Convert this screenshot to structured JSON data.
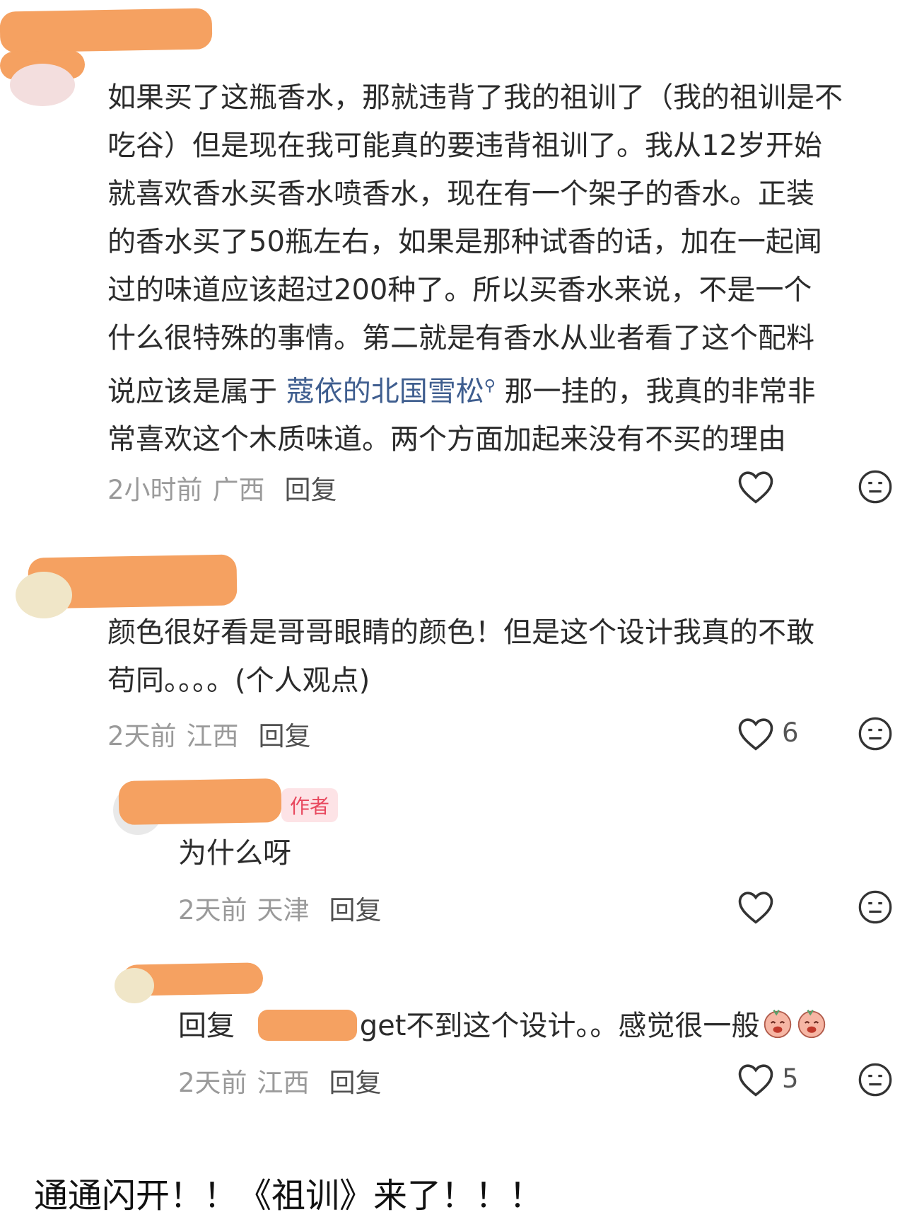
{
  "comments": [
    {
      "lines": [
        "如果买了这瓶香水，那就违背了我的祖训了（我的祖训是不",
        "吃谷）但是现在我可能真的要违背祖训了。我从12岁开始",
        "就喜欢香水买香水喷香水，现在有一个架子的香水。正装",
        "的香水买了50瓶左右，如果是那种试香的话，加在一起闻",
        "过的味道应该超过200种了。所以买香水来说，不是一个",
        "什么很特殊的事情。第二就是有香水从业者看了这个配料"
      ],
      "line7_pre": "说应该是属于 ",
      "line7_link": "蔻依的北国雪松",
      "line7_post": " 那一挂的，我真的非常非",
      "line8": "常喜欢这个木质味道。两个方面加起来没有不买的理由",
      "time": "2小时前",
      "region": "广西",
      "reply": "回复"
    },
    {
      "lines": [
        "颜色很好看是哥哥眼睛的颜色！但是这个设计我真的不敢",
        "苟同。。。。(个人观点)"
      ],
      "time": "2天前",
      "region": "江西",
      "reply": "回复",
      "likes": "6"
    },
    {
      "badge": "作者",
      "text": "为什么呀",
      "time": "2天前",
      "region": "天津",
      "reply": "回复"
    },
    {
      "reply_prefix": "回复",
      "text": "get不到这个设计。。感觉很一般",
      "time": "2天前",
      "region": "江西",
      "reply": "回复",
      "likes": "5"
    }
  ],
  "caption": "通通闪开！！《祖训》来了！！！",
  "icons": {
    "like": "heart-outline-icon",
    "dislike": "meh-face-icon",
    "link": "search-icon"
  },
  "colors": {
    "redaction": "#f5a161",
    "link": "#3f5e8f",
    "badge": "#e8485e"
  }
}
